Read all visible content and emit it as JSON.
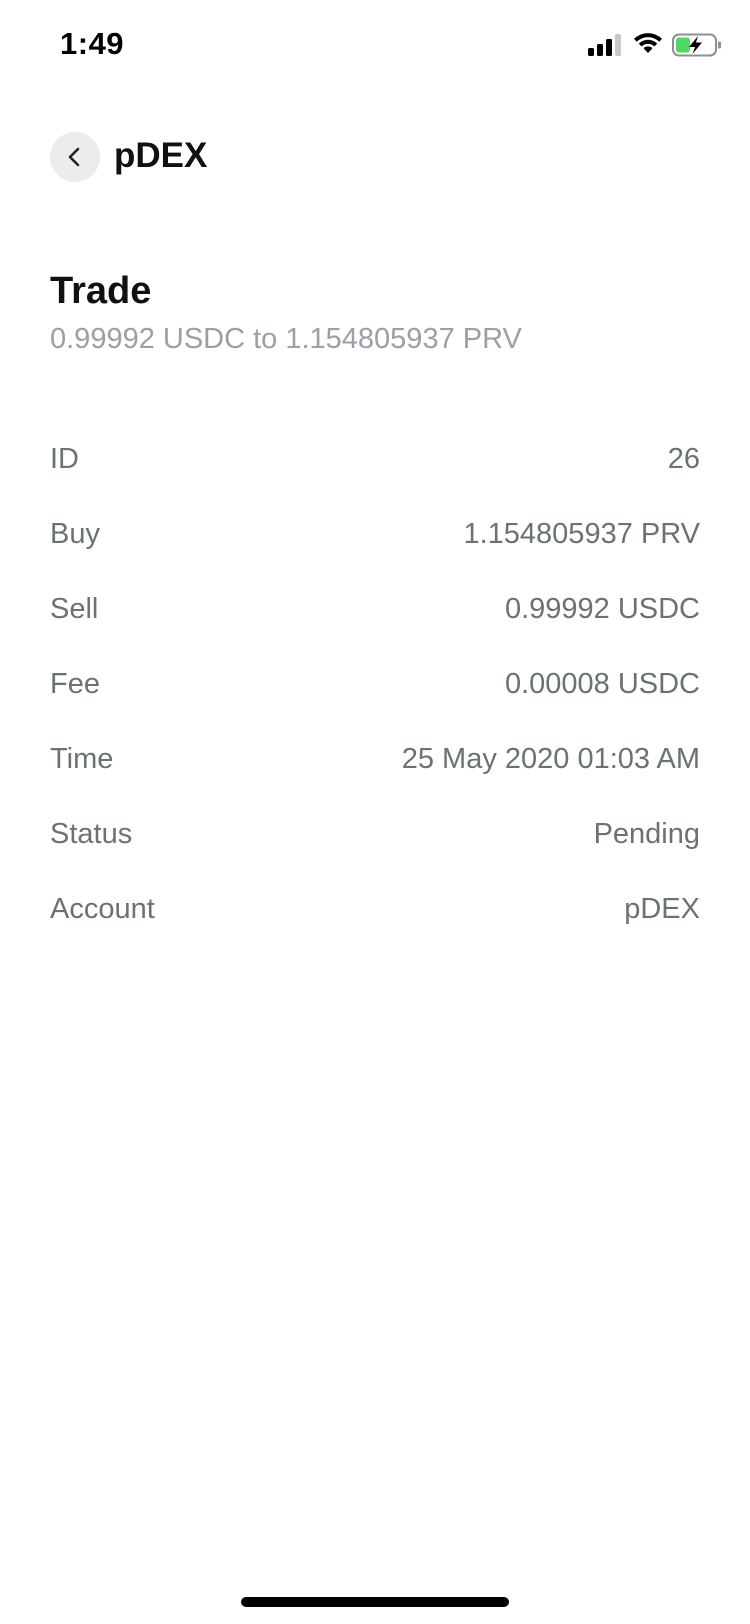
{
  "status_bar": {
    "time": "1:49",
    "icons": [
      "cellular-signal-icon",
      "wifi-icon",
      "battery-charging-icon"
    ],
    "battery_color": "#4cd964"
  },
  "header": {
    "back_icon": "chevron-left-icon",
    "title": "pDEX"
  },
  "summary": {
    "title": "Trade",
    "subtitle": "0.99992 USDC to 1.154805937 PRV"
  },
  "details": [
    {
      "label": "ID",
      "value": "26"
    },
    {
      "label": "Buy",
      "value": "1.154805937 PRV"
    },
    {
      "label": "Sell",
      "value": "0.99992 USDC"
    },
    {
      "label": "Fee",
      "value": "0.00008 USDC"
    },
    {
      "label": "Time",
      "value": "25 May 2020 01:03 AM"
    },
    {
      "label": "Status",
      "value": "Pending"
    },
    {
      "label": "Account",
      "value": "pDEX"
    }
  ],
  "colors": {
    "text_primary": "#111111",
    "text_secondary": "#9aa0a6",
    "detail_text": "#6b7274",
    "back_button_bg": "#ececec"
  }
}
